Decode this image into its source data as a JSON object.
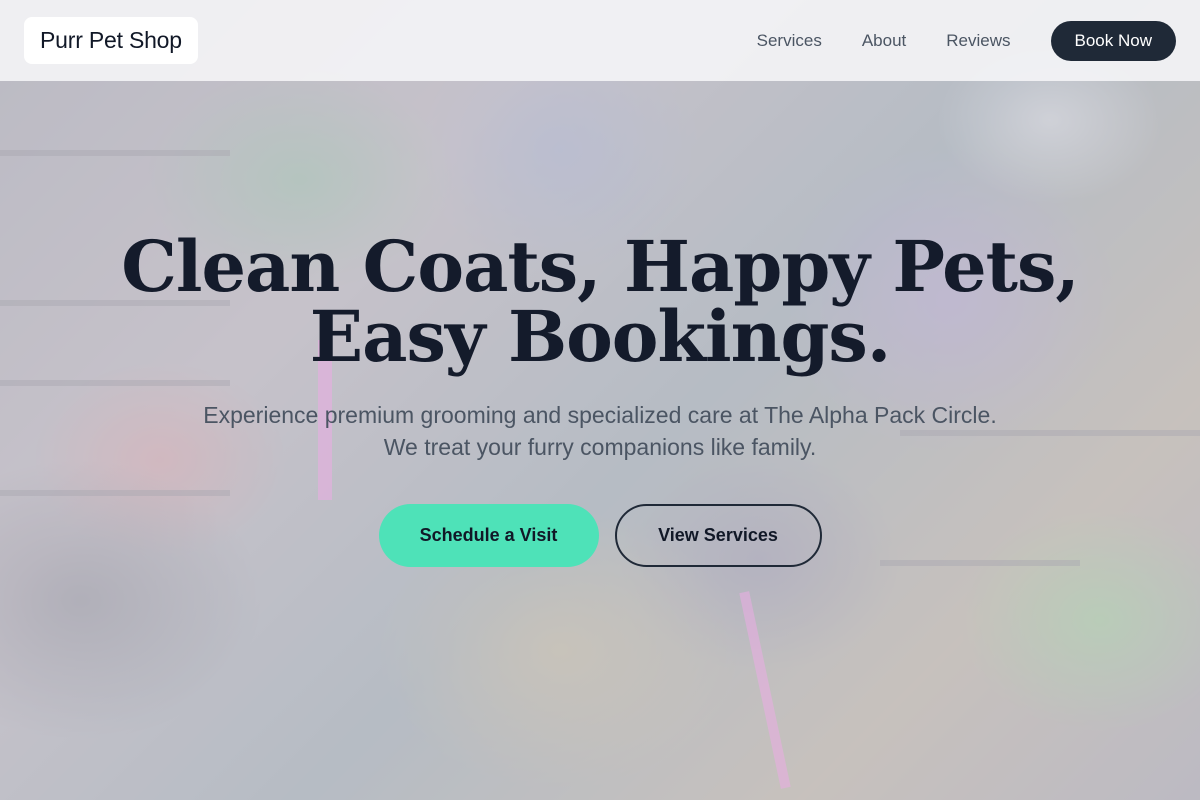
{
  "header": {
    "brand": "Purr Pet Shop",
    "nav": [
      "Services",
      "About",
      "Reviews"
    ],
    "cta": "Book Now"
  },
  "hero": {
    "headline_line1": "Clean Coats, Happy Pets,",
    "headline_line2": "Easy Bookings.",
    "subtext": "Experience premium grooming and specialized care at The Alpha Pack Circle. We treat your furry companions like family.",
    "primary_button": "Schedule a Visit",
    "secondary_button": "View Services"
  },
  "colors": {
    "header_bg": "#f6f6f8",
    "book_button_bg": "#1f2937",
    "primary_button_bg": "#4ee2b8",
    "headline_text": "#141b2b",
    "body_text": "#4b5563"
  },
  "background": {
    "description_icon": "shop-photo"
  }
}
